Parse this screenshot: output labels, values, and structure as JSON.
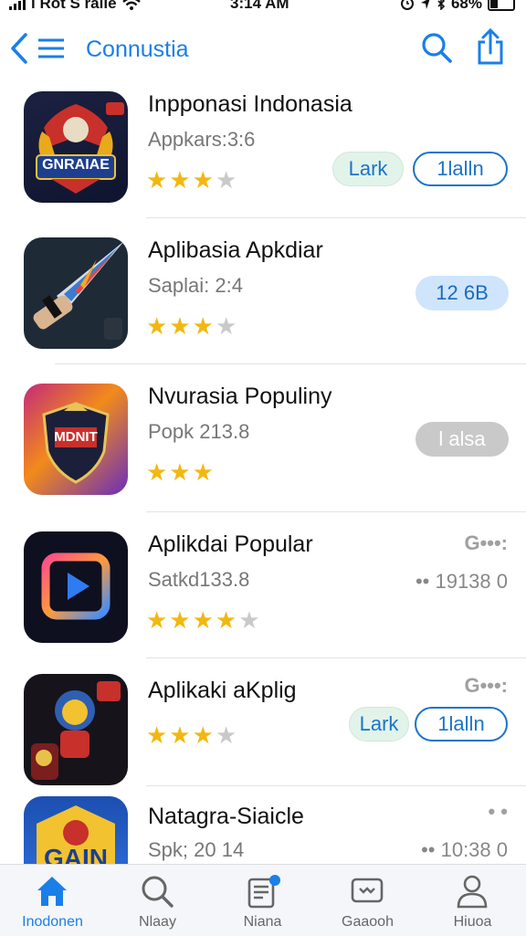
{
  "status_bar": {
    "carrier": "l Rot S ralle",
    "time": "3:14 AM",
    "battery": "68%"
  },
  "nav": {
    "title": "Connustia"
  },
  "apps": [
    {
      "name": "Inpponasi Indonasia",
      "sub": "Appkars:3:6",
      "rating": 3,
      "badge": "GNRAIAE",
      "buttons": [
        "Lark",
        "1lalln"
      ]
    },
    {
      "name": "Aplibasia Apkdiar",
      "sub": "Saplai: 2:4",
      "rating": 3,
      "size": "12 6B"
    },
    {
      "name": "Nvurasia Populiny",
      "sub": "Popk 213.8",
      "rating": 3,
      "badge": "MDNIT",
      "gray_button": "l alsa"
    },
    {
      "name": "Aplikdai Popular",
      "sub": "Satkd133.8",
      "rating": 4,
      "right_top": "G•••:",
      "right_value": "•• 19138 0"
    },
    {
      "name": "Aplikaki aKplig",
      "rating": 3,
      "right_top": "G•••:",
      "buttons": [
        "Lark",
        "1lalln"
      ]
    },
    {
      "name": "Natagra-Siaicle",
      "sub": "Spk; 20 14",
      "badge": "GAIN",
      "right_top": "• •",
      "right_value": "•• 10:38 0"
    }
  ],
  "tabs": [
    {
      "label": "Inodonen",
      "icon": "home-icon"
    },
    {
      "label": "Nlaay",
      "icon": "search-icon"
    },
    {
      "label": "Niana",
      "icon": "news-icon"
    },
    {
      "label": "Gaaooh",
      "icon": "chat-icon"
    },
    {
      "label": "Hiuoa",
      "icon": "person-icon"
    }
  ],
  "colors": {
    "accent": "#1a7fe8",
    "star": "#f2b811"
  }
}
